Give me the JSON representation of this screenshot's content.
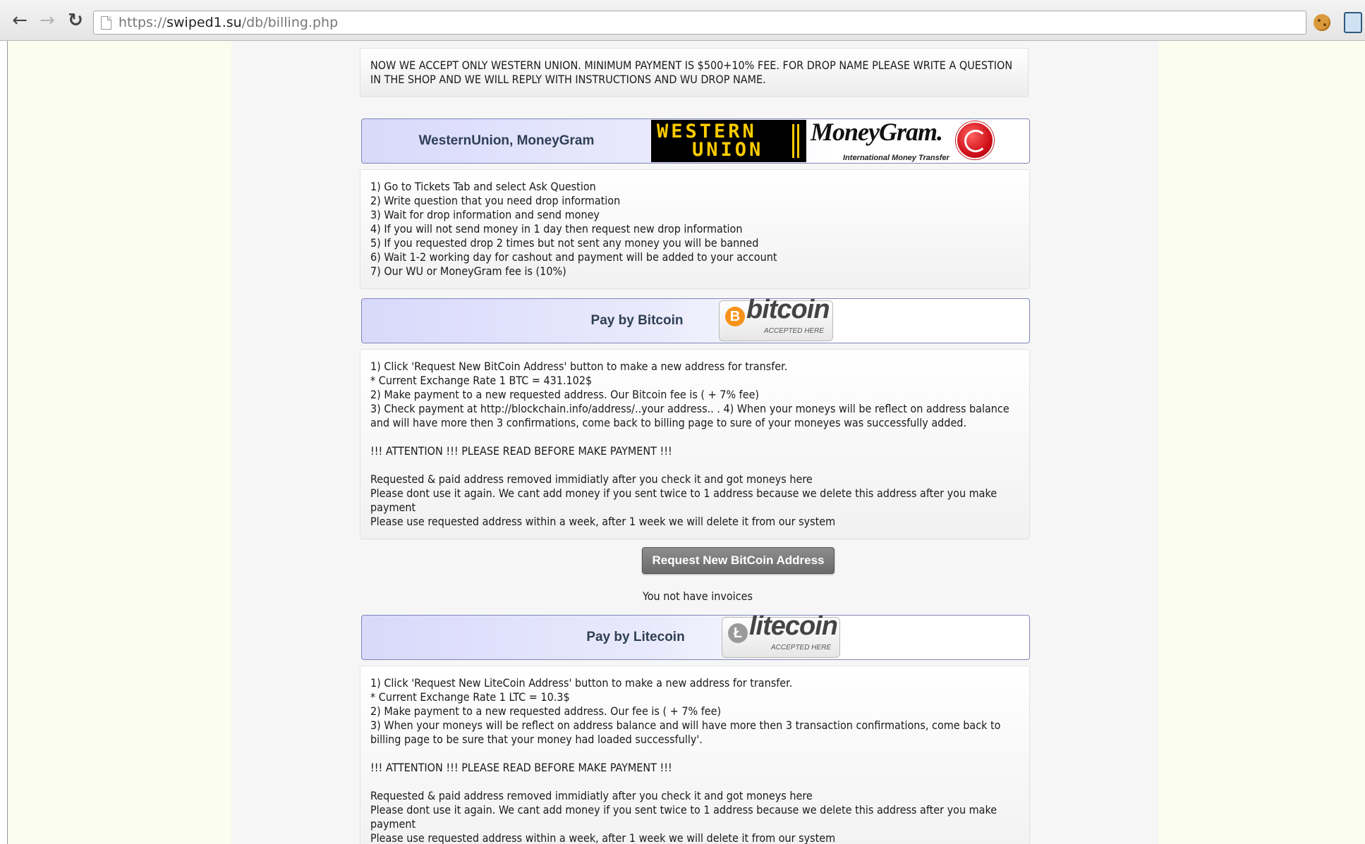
{
  "browser": {
    "url_scheme": "https://",
    "url_host": "swiped1.su",
    "url_path": "/db/billing.php",
    "back_glyph": "←",
    "forward_glyph": "→",
    "reload_glyph": "↻"
  },
  "notice": {
    "text": "NOW WE ACCEPT ONLY WESTERN UNION. MINIMUM PAYMENT IS $500+10% FEE. FOR DROP NAME PLEASE WRITE A QUESTION IN THE SHOP AND WE WILL REPLY WITH INSTRUCTIONS AND WU DROP NAME."
  },
  "wu_section": {
    "title": "WesternUnion, MoneyGram",
    "wu_logo_line1": "WESTERN",
    "wu_logo_line2": "UNION",
    "mg_logo_text": "MoneyGram.",
    "mg_logo_sub": "International Money Transfer",
    "steps": [
      "1) Go to Tickets Tab and select Ask Question",
      "2) Write question that you need drop information",
      "3) Wait for drop information and send money",
      "4) If you will not send money in 1 day then request new drop information",
      "5) If you requested drop 2 times but not sent any money you will be banned",
      "6) Wait 1-2 working day for cashout and payment will be added to your account",
      "7) Our WU or MoneyGram fee is (10%)"
    ]
  },
  "btc_section": {
    "title": "Pay by Bitcoin",
    "logo_word": "bitcoin",
    "logo_symbol": "B",
    "logo_accepted": "ACCEPTED HERE",
    "lines": [
      "1) Click 'Request New BitCoin Address' button to make a new address for transfer.",
      "* Current Exchange Rate 1 BTC = 431.102$",
      "2) Make payment to a new requested address. Our Bitcoin fee is ( + 7% fee)",
      "3) Check payment at http://blockchain.info/address/..your address.. . 4) When your moneys will be reflect on address balance and will have more then 3 confirmations, come back to billing page to sure of your moneyes was successfully added."
    ],
    "attention": "!!! ATTENTION !!! PLEASE READ BEFORE MAKE PAYMENT !!!",
    "warnings": [
      "Requested & paid address removed immidiatly after you check it and got moneys here",
      "Please dont use it again. We cant add money if you sent twice to 1 address because we delete this address after you make payment",
      "Please use requested address within a week, after 1 week we will delete it from our system"
    ],
    "button_label": "Request New BitCoin Address",
    "invoices_text": "You not have invoices"
  },
  "ltc_section": {
    "title": "Pay by Litecoin",
    "logo_word": "litecoin",
    "logo_symbol": "Ł",
    "logo_accepted": "ACCEPTED HERE",
    "lines": [
      "1) Click 'Request New LiteCoin Address' button to make a new address for transfer.",
      "* Current Exchange Rate 1 LTC = 10.3$",
      "2) Make payment to a new requested address. Our fee is ( + 7% fee)",
      "3) When your moneys will be reflect on address balance and will have more then 3 transaction confirmations, come back to billing page to be sure that your money had loaded successfully'."
    ],
    "attention": "!!! ATTENTION !!! PLEASE READ BEFORE MAKE PAYMENT !!!",
    "warnings": [
      "Requested & paid address removed immidiatly after you check it and got moneys here",
      "Please dont use it again. We cant add money if you sent twice to 1 address because we delete this address after you make payment",
      "Please use requested address within a week, after 1 week we will delete it from our system"
    ]
  },
  "colors": {
    "page_bg": "#fbfdee",
    "column_bg": "#f6f6f6",
    "banner_start": "#d8d9fb",
    "banner_border": "#7f86b8",
    "bitcoin_orange": "#f7931a",
    "wu_yellow": "#ffcc00",
    "moneygram_red": "#d0101a"
  }
}
